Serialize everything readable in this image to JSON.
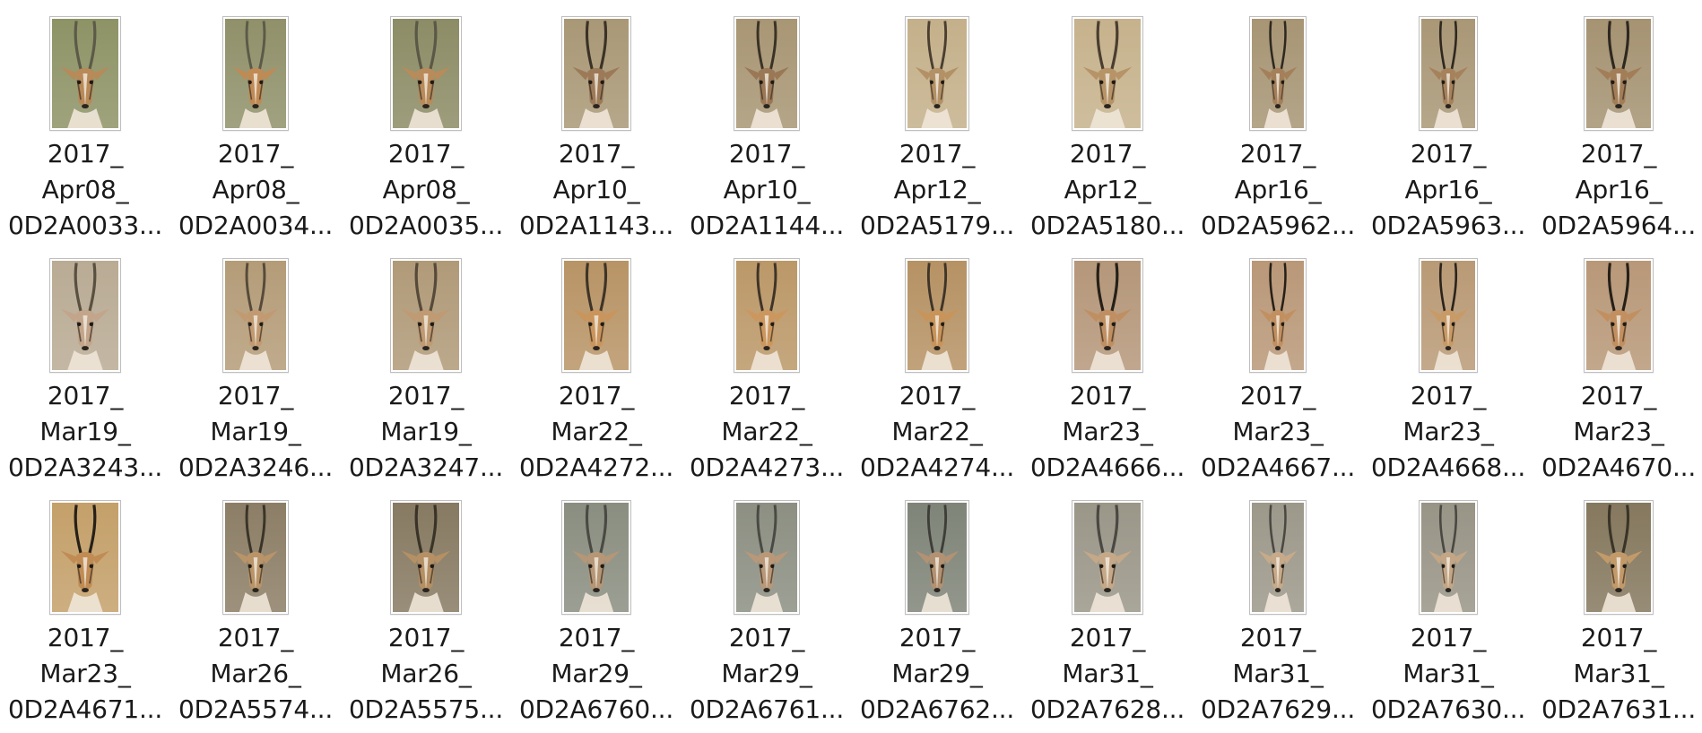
{
  "file_browser": {
    "view": "icon-grid",
    "icon_name": "gazelle-thumbnail-icon",
    "items": [
      {
        "line1": "2017_",
        "line2": "Apr08_",
        "line3": "0D2A0033...",
        "tone": {
          "bg": "#8e9366",
          "fur": "#b88a58",
          "horn": "#5c5a48"
        }
      },
      {
        "line1": "2017_",
        "line2": "Apr08_",
        "line3": "0D2A0034...",
        "tone": {
          "bg": "#90916a",
          "fur": "#c08a55",
          "horn": "#5c5a48"
        }
      },
      {
        "line1": "2017_",
        "line2": "Apr08_",
        "line3": "0D2A0035...",
        "tone": {
          "bg": "#8c8c66",
          "fur": "#b98b5a",
          "horn": "#5a5846"
        }
      },
      {
        "line1": "2017_",
        "line2": "Apr10_",
        "line3": "0D2A1143...",
        "tone": {
          "bg": "#a99876",
          "fur": "#9c7a58",
          "horn": "#3a3226"
        }
      },
      {
        "line1": "2017_",
        "line2": "Apr10_",
        "line3": "0D2A1144...",
        "tone": {
          "bg": "#a89674",
          "fur": "#9a7856",
          "horn": "#3a3226"
        }
      },
      {
        "line1": "2017_",
        "line2": "Apr12_",
        "line3": "0D2A5179...",
        "tone": {
          "bg": "#c4b08a",
          "fur": "#b39166",
          "horn": "#4a3e30"
        }
      },
      {
        "line1": "2017_",
        "line2": "Apr12_",
        "line3": "0D2A5180...",
        "tone": {
          "bg": "#c6b28c",
          "fur": "#b69468",
          "horn": "#4a3e30"
        }
      },
      {
        "line1": "2017_",
        "line2": "Apr16_",
        "line3": "0D2A5962...",
        "tone": {
          "bg": "#a79574",
          "fur": "#a4805a",
          "horn": "#2e2820"
        }
      },
      {
        "line1": "2017_",
        "line2": "Apr16_",
        "line3": "0D2A5963...",
        "tone": {
          "bg": "#a99776",
          "fur": "#a6825c",
          "horn": "#2e2820"
        }
      },
      {
        "line1": "2017_",
        "line2": "Apr16_",
        "line3": "0D2A5964...",
        "tone": {
          "bg": "#a59372",
          "fur": "#a27e58",
          "horn": "#2e2820"
        }
      },
      {
        "line1": "2017_",
        "line2": "Mar19_",
        "line3": "0D2A3243...",
        "tone": {
          "bg": "#b9ab94",
          "fur": "#c2a58a",
          "horn": "#5a5040"
        }
      },
      {
        "line1": "2017_",
        "line2": "Mar19_",
        "line3": "0D2A3246...",
        "tone": {
          "bg": "#b49c78",
          "fur": "#c19a72",
          "horn": "#564a3a"
        }
      },
      {
        "line1": "2017_",
        "line2": "Mar19_",
        "line3": "0D2A3247...",
        "tone": {
          "bg": "#b09a78",
          "fur": "#bf9a72",
          "horn": "#564a3a"
        }
      },
      {
        "line1": "2017_",
        "line2": "Mar22_",
        "line3": "0D2A4272...",
        "tone": {
          "bg": "#b89466",
          "fur": "#c9955c",
          "horn": "#3e3428"
        }
      },
      {
        "line1": "2017_",
        "line2": "Mar22_",
        "line3": "0D2A4273...",
        "tone": {
          "bg": "#bb9868",
          "fur": "#cb975e",
          "horn": "#3e3428"
        }
      },
      {
        "line1": "2017_",
        "line2": "Mar22_",
        "line3": "0D2A4274...",
        "tone": {
          "bg": "#b69264",
          "fur": "#c8945a",
          "horn": "#3e3428"
        }
      },
      {
        "line1": "2017_",
        "line2": "Mar23_",
        "line3": "0D2A4666...",
        "tone": {
          "bg": "#b5977a",
          "fur": "#bf8f62",
          "horn": "#262018"
        }
      },
      {
        "line1": "2017_",
        "line2": "Mar23_",
        "line3": "0D2A4667...",
        "tone": {
          "bg": "#b99878",
          "fur": "#c29060",
          "horn": "#262018"
        }
      },
      {
        "line1": "2017_",
        "line2": "Mar23_",
        "line3": "0D2A4668...",
        "tone": {
          "bg": "#b99a76",
          "fur": "#c89a66",
          "horn": "#2a241c"
        }
      },
      {
        "line1": "2017_",
        "line2": "Mar23_",
        "line3": "0D2A4670...",
        "tone": {
          "bg": "#b89878",
          "fur": "#c28f60",
          "horn": "#262018"
        }
      },
      {
        "line1": "2017_",
        "line2": "Mar23_",
        "line3": "0D2A4671...",
        "tone": {
          "bg": "#c4a06a",
          "fur": "#c08c54",
          "horn": "#262018"
        }
      },
      {
        "line1": "2017_",
        "line2": "Mar26_",
        "line3": "0D2A5574...",
        "tone": {
          "bg": "#8c7e66",
          "fur": "#b99468",
          "horn": "#3a3428"
        }
      },
      {
        "line1": "2017_",
        "line2": "Mar26_",
        "line3": "0D2A5575...",
        "tone": {
          "bg": "#877a62",
          "fur": "#b59064",
          "horn": "#3a3428"
        }
      },
      {
        "line1": "2017_",
        "line2": "Mar29_",
        "line3": "0D2A6760...",
        "tone": {
          "bg": "#8a8e80",
          "fur": "#b59676",
          "horn": "#4a4a44"
        }
      },
      {
        "line1": "2017_",
        "line2": "Mar29_",
        "line3": "0D2A6761...",
        "tone": {
          "bg": "#8c8f82",
          "fur": "#b89878",
          "horn": "#4a4a44"
        }
      },
      {
        "line1": "2017_",
        "line2": "Mar29_",
        "line3": "0D2A6762...",
        "tone": {
          "bg": "#7f8478",
          "fur": "#b29272",
          "horn": "#3e3e38"
        }
      },
      {
        "line1": "2017_",
        "line2": "Mar31_",
        "line3": "0D2A7628...",
        "tone": {
          "bg": "#9a9688",
          "fur": "#c4a888",
          "horn": "#4a4842"
        }
      },
      {
        "line1": "2017_",
        "line2": "Mar31_",
        "line3": "0D2A7629...",
        "tone": {
          "bg": "#9c988a",
          "fur": "#c6aa8a",
          "horn": "#4a4842"
        }
      },
      {
        "line1": "2017_",
        "line2": "Mar31_",
        "line3": "0D2A7630...",
        "tone": {
          "bg": "#989486",
          "fur": "#c2a686",
          "horn": "#4a4842"
        }
      },
      {
        "line1": "2017_",
        "line2": "Mar31_",
        "line3": "0D2A7631...",
        "tone": {
          "bg": "#85785e",
          "fur": "#c29a6a",
          "horn": "#3a3428"
        }
      }
    ]
  }
}
